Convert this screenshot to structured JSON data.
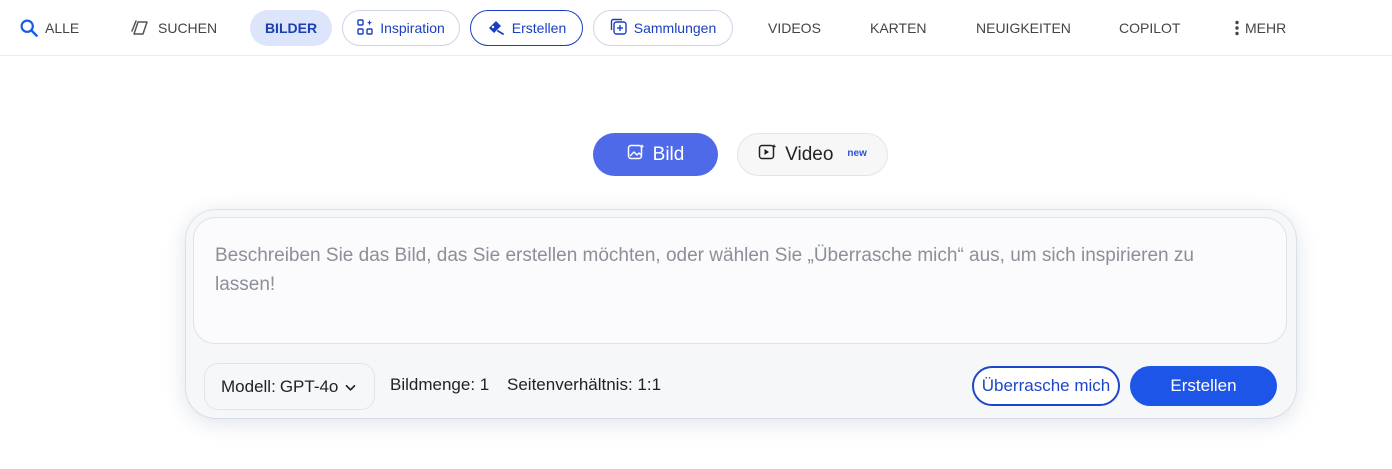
{
  "nav": {
    "all": "Alle",
    "search": "Suchen",
    "images": "Bilder",
    "inspiration": "Inspiration",
    "create": "Erstellen",
    "collections": "Sammlungen",
    "videos": "Videos",
    "maps": "Karten",
    "news": "Neuigkeiten",
    "copilot": "Copilot",
    "more": "Mehr"
  },
  "mode": {
    "image": "Bild",
    "video": "Video",
    "video_badge": "new"
  },
  "prompt": {
    "placeholder": "Beschreiben Sie das Bild, das Sie erstellen möchten, oder wählen Sie „Überrasche mich“ aus, um sich inspirieren zu lassen!"
  },
  "options": {
    "model_label": "Modell:",
    "model_value": "GPT-4o",
    "quantity": "Bildmenge: 1",
    "aspect": "Seitenverhältnis: 1:1"
  },
  "actions": {
    "surprise": "Überrasche mich",
    "create": "Erstellen"
  },
  "colors": {
    "accent": "#1d55e8",
    "mode_active": "#4f6ae9",
    "nav_active_bg": "#dce5fb",
    "link": "#1a3fc2"
  }
}
